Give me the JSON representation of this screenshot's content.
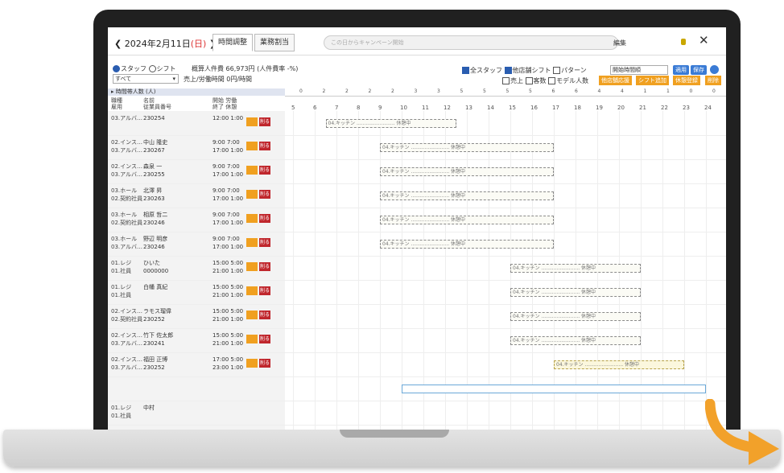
{
  "header": {
    "date_label": "2024年2月11日",
    "weekday": "(日)",
    "tabs": [
      "時間調整",
      "業務割当"
    ],
    "search_placeholder": "この日からキャンペーン開始",
    "edit_label": "編集",
    "close_glyph": "✕"
  },
  "filters": {
    "radio_staff": "スタッフ",
    "radio_shift": "シフト",
    "summary_text": "概算人件費 66,973円 (人件費率 -%)",
    "select_value": "すべて",
    "sales_label": "売上/労働時間 0円/時間",
    "checks_row1": [
      "全スタッフ",
      "他店舗シフト",
      "パターン"
    ],
    "checks_row2": [
      "売上",
      "客数",
      "モデル人数"
    ],
    "dropdown_value": "開始時間順",
    "blue_buttons": [
      "適用",
      "保存"
    ],
    "orange_buttons": [
      "他店舗応援",
      "シフト追加",
      "休憩登録",
      "削除"
    ]
  },
  "grid": {
    "group_label": "▸ 時間帯人数 (人)",
    "col_headers": [
      "職種\n雇用",
      "名前\n従業員番号",
      "開始 労働\n終了 休憩"
    ],
    "hours": [
      "5",
      "6",
      "7",
      "8",
      "9",
      "10",
      "11",
      "12",
      "13",
      "14",
      "15",
      "16",
      "17",
      "18",
      "19",
      "20",
      "21",
      "22",
      "23",
      "24"
    ],
    "counts": [
      "0",
      "2",
      "2",
      "2",
      "2",
      "3",
      "3",
      "5",
      "5",
      "5",
      "5",
      "6",
      "6",
      "4",
      "4",
      "1",
      "1",
      "0",
      "0"
    ],
    "badge_label": "削る"
  },
  "rows": [
    {
      "role1": "03.アルバ…",
      "role2": "",
      "name1": "",
      "name2": "230254",
      "time1": "12:00 1:00",
      "time2": ""
    },
    {
      "role1": "02.インス…",
      "role2": "03.アルバ…",
      "name1": "中山 隆史",
      "name2": "230267",
      "time1": "9:00 7:00",
      "time2": "17:00 1:00"
    },
    {
      "role1": "02.インス…",
      "role2": "03.アルバ…",
      "name1": "森泉 一",
      "name2": "230255",
      "time1": "9:00 7:00",
      "time2": "17:00 1:00"
    },
    {
      "role1": "03.ホール",
      "role2": "02.契約社員",
      "name1": "北澤 昇",
      "name2": "230263",
      "time1": "9:00 7:00",
      "time2": "17:00 1:00"
    },
    {
      "role1": "03.ホール",
      "role2": "02.契約社員",
      "name1": "相原 哲二",
      "name2": "230246",
      "time1": "9:00 7:00",
      "time2": "17:00 1:00"
    },
    {
      "role1": "03.ホール",
      "role2": "03.アルバ…",
      "name1": "野辺 明彦",
      "name2": "230246",
      "time1": "9:00 7:00",
      "time2": "17:00 1:00"
    },
    {
      "role1": "01.レジ",
      "role2": "01.社員",
      "name1": "ひいた",
      "name2": "0000000",
      "time1": "15:00 5:00",
      "time2": "21:00 1:00"
    },
    {
      "role1": "01.レジ",
      "role2": "01.社員",
      "name1": "白幡 真紀",
      "name2": "",
      "time1": "15:00 5:00",
      "time2": "21:00 1:00"
    },
    {
      "role1": "02.インス…",
      "role2": "02.契約社員",
      "name1": "ラモス瑠偉",
      "name2": "230252",
      "time1": "15:00 5:00",
      "time2": "21:00 1:00"
    },
    {
      "role1": "02.インス…",
      "role2": "03.アルバ…",
      "name1": "竹下 佐太郎",
      "name2": "230241",
      "time1": "15:00 5:00",
      "time2": "21:00 1:00"
    },
    {
      "role1": "02.インス…",
      "role2": "03.アルバ…",
      "name1": "福田 正博",
      "name2": "230252",
      "time1": "17:00 5:00",
      "time2": "23:00 1:00"
    },
    {
      "role1": "",
      "role2": "",
      "name1": "",
      "name2": "",
      "time1": "",
      "time2": ""
    },
    {
      "role1": "01.レジ",
      "role2": "01.社員",
      "name1": "中村",
      "name2": "",
      "time1": "",
      "time2": ""
    }
  ],
  "bar_labels": {
    "a": "04.キッチン",
    "b": "休憩中"
  }
}
